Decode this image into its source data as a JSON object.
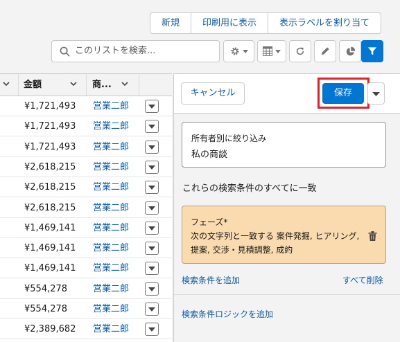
{
  "toolbar": {
    "new_label": "新規",
    "print_label": "印刷用に表示",
    "assign_label": "表示ラベルを割り当て"
  },
  "search": {
    "placeholder": "このリストを検索..."
  },
  "icons": {
    "settings": "gear-icon",
    "display": "table-icon",
    "refresh": "refresh-icon",
    "edit": "pencil-icon",
    "chart": "pie-chart-icon",
    "filter": "filter-icon"
  },
  "table": {
    "columns": [
      "金額",
      "商..."
    ],
    "rows": [
      {
        "amount": "¥1,721,493",
        "owner": "営業二郎"
      },
      {
        "amount": "¥1,721,493",
        "owner": "営業二郎"
      },
      {
        "amount": "¥1,721,493",
        "owner": "営業二郎"
      },
      {
        "amount": "¥2,618,215",
        "owner": "営業二郎"
      },
      {
        "amount": "¥2,618,215",
        "owner": "営業二郎"
      },
      {
        "amount": "¥2,618,215",
        "owner": "営業二郎"
      },
      {
        "amount": "¥1,469,141",
        "owner": "営業二郎"
      },
      {
        "amount": "¥1,469,141",
        "owner": "営業二郎"
      },
      {
        "amount": "¥1,469,141",
        "owner": "営業二郎"
      },
      {
        "amount": "¥554,278",
        "owner": "営業二郎"
      },
      {
        "amount": "¥554,278",
        "owner": "営業二郎"
      },
      {
        "amount": "¥2,389,682",
        "owner": "営業二郎"
      }
    ]
  },
  "filter_panel": {
    "cancel_label": "キャンセル",
    "save_label": "保存",
    "owner_filter": {
      "label": "所有者別に絞り込み",
      "value": "私の商談"
    },
    "match_text": "これらの検索条件のすべてに一致",
    "criterion": {
      "field": "フェーズ*",
      "description": "次の文字列と一致する 案件発掘, ヒアリング, 提案, 交渉・見積調整, 成約"
    },
    "add_criteria_label": "検索条件を追加",
    "remove_all_label": "すべて削除",
    "add_logic_label": "検索条件ロジックを追加"
  },
  "colors": {
    "brand": "#0176d3",
    "link": "#0b5cab",
    "criterion_bg": "#f9dbaf",
    "highlight": "#e0202b"
  }
}
